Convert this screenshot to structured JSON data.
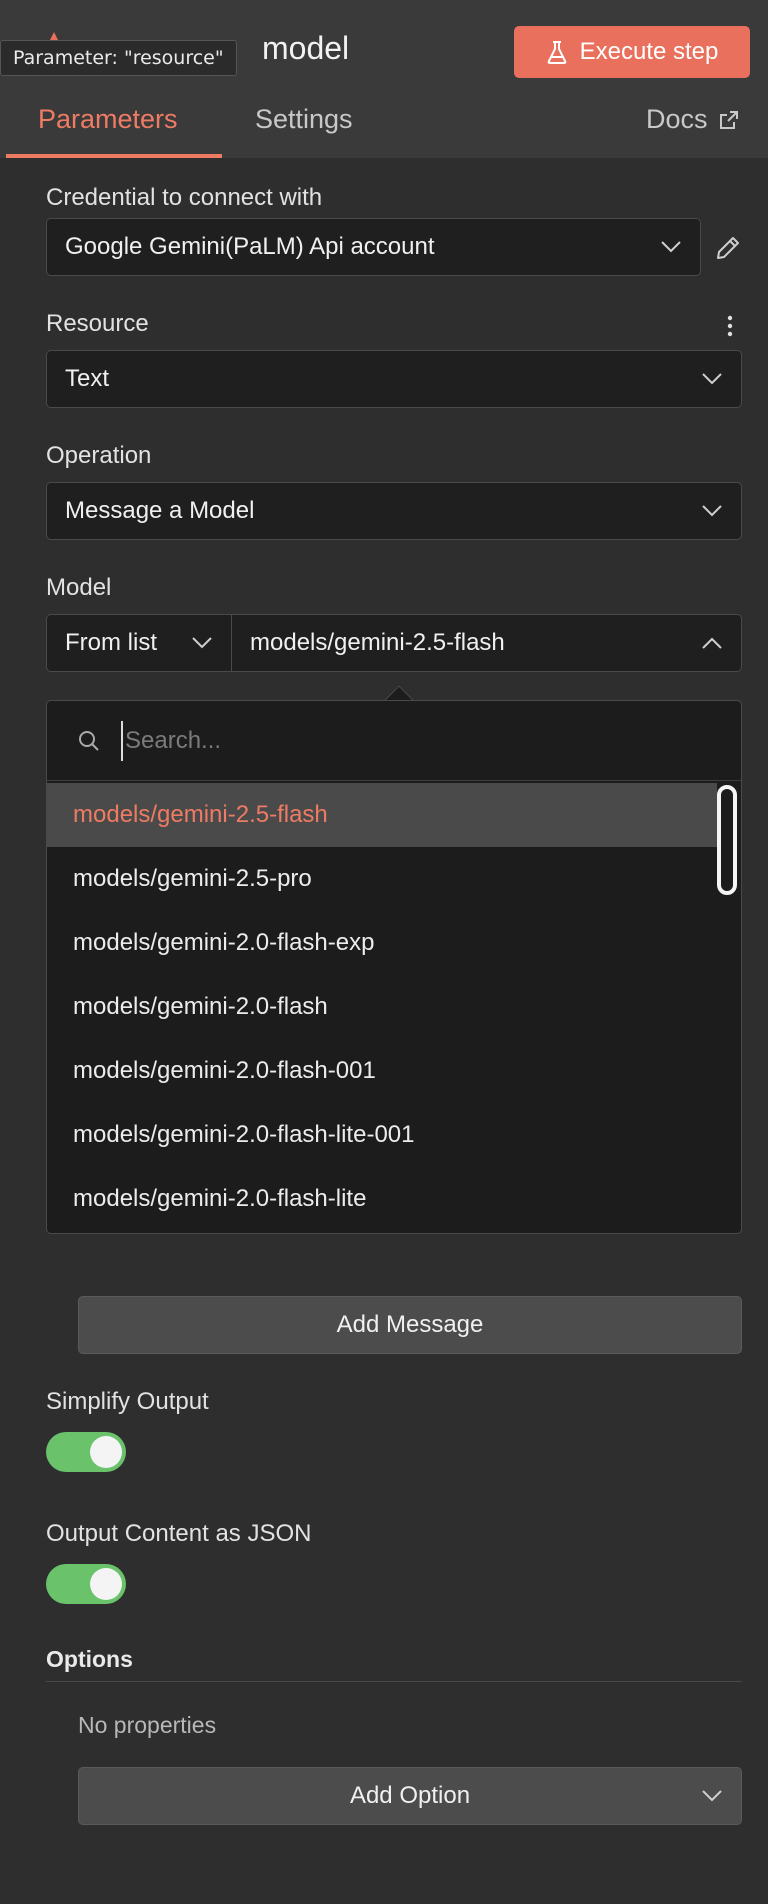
{
  "header": {
    "title": "model",
    "tooltip": "Parameter: \"resource\"",
    "execute_label": "Execute step",
    "tabs": [
      {
        "label": "Parameters",
        "active": true
      },
      {
        "label": "Settings",
        "active": false
      }
    ],
    "docs_label": "Docs"
  },
  "credential": {
    "label": "Credential to connect with",
    "value": "Google Gemini(PaLM) Api account"
  },
  "resource": {
    "label": "Resource",
    "value": "Text"
  },
  "operation": {
    "label": "Operation",
    "value": "Message a Model"
  },
  "model": {
    "label": "Model",
    "mode": "From list",
    "value": "models/gemini-2.5-flash"
  },
  "model_dropdown": {
    "search_placeholder": "Search...",
    "options": [
      "models/gemini-2.5-flash",
      "models/gemini-2.5-pro",
      "models/gemini-2.0-flash-exp",
      "models/gemini-2.0-flash",
      "models/gemini-2.0-flash-001",
      "models/gemini-2.0-flash-lite-001",
      "models/gemini-2.0-flash-lite"
    ],
    "selected_index": 0
  },
  "add_message_label": "Add Message",
  "simplify_output": {
    "label": "Simplify Output",
    "enabled": true
  },
  "output_json": {
    "label": "Output Content as JSON",
    "enabled": true
  },
  "options": {
    "title": "Options",
    "empty_text": "No properties",
    "add_label": "Add Option"
  },
  "colors": {
    "accent": "#ee7b63",
    "execute_button": "#e9705c",
    "toggle_on": "#6ac36b",
    "background": "#2e2e2e",
    "input_bg": "#1f1f1f"
  }
}
